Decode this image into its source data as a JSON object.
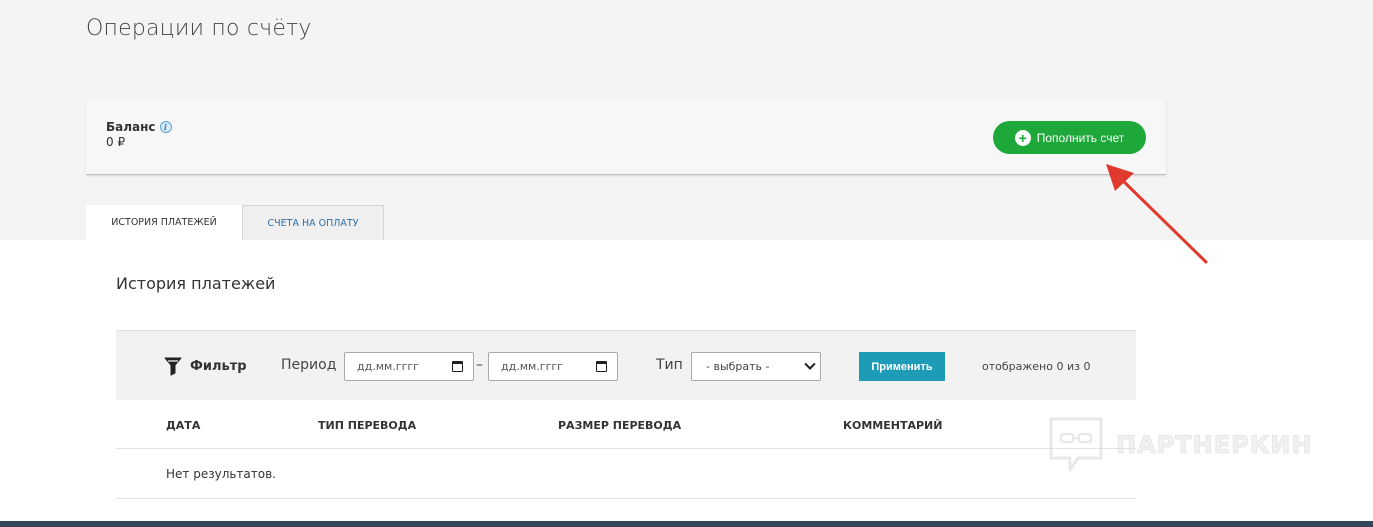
{
  "header": {
    "title": "Операции по счёту"
  },
  "balance": {
    "label": "Баланс",
    "info_icon": "i",
    "value": "0 ₽",
    "topup_button": "Пополнить счет"
  },
  "tabs": [
    {
      "label": "ИСТОРИЯ ПЛАТЕЖЕЙ",
      "active": true
    },
    {
      "label": "СЧЕТА НА ОПЛАТУ",
      "active": false
    }
  ],
  "history": {
    "title": "История платежей",
    "filter": {
      "label": "Фильтр",
      "period_label": "Период",
      "date_from_placeholder": "дд.мм.гггг",
      "separator": "–",
      "date_to_placeholder": "дд.мм.гггг",
      "type_label": "Тип",
      "type_selected": "- выбрать -",
      "apply_button": "Применить",
      "shown_count": "отображено 0 из 0"
    },
    "columns": [
      "ДАТА",
      "ТИП ПЕРЕВОДА",
      "РАЗМЕР ПЕРЕВОДА",
      "КОММЕНТАРИЙ"
    ],
    "empty_text": "Нет результатов."
  },
  "watermark": {
    "text": "ПАРТНЕРКИН"
  },
  "colors": {
    "topup_green": "#1fa83a",
    "apply_teal": "#1e9bb6",
    "tab_link_blue": "#2e6fa8",
    "arrow_red": "#e03a2e"
  }
}
